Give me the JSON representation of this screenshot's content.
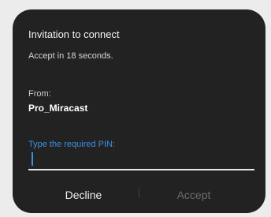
{
  "dialog": {
    "title": "Invitation to connect",
    "subtitle": "Accept in 18 seconds.",
    "from_label": "From:",
    "device_name": "Pro_Miracast",
    "pin_label": "Type the required PIN:",
    "pin_value": "",
    "decline_label": "Decline",
    "accept_label": "Accept"
  },
  "colors": {
    "dialog_background": "#222222",
    "accent": "#3e8fe6",
    "disabled_text": "#6b6b6b"
  }
}
